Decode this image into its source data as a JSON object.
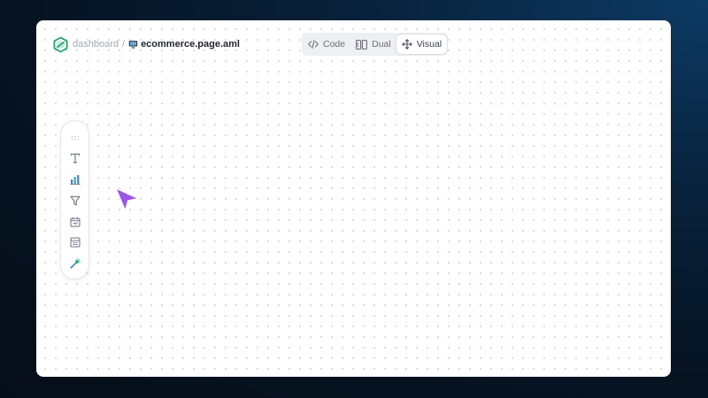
{
  "breadcrumb": {
    "root": "dashboard",
    "separator": "/",
    "file_icon": "monitor-icon",
    "file": "ecommerce.page.aml"
  },
  "mode_switch": {
    "options": [
      {
        "label": "Code",
        "icon": "code-icon",
        "active": false
      },
      {
        "label": "Dual",
        "icon": "split-view-icon",
        "active": false
      },
      {
        "label": "Visual",
        "icon": "move-arrows-icon",
        "active": true
      }
    ]
  },
  "toolbar": {
    "items": [
      {
        "name": "drag-handle-icon"
      },
      {
        "name": "text-icon"
      },
      {
        "name": "bar-chart-icon"
      },
      {
        "name": "filter-icon"
      },
      {
        "name": "date-filter-icon"
      },
      {
        "name": "table-icon"
      },
      {
        "name": "magic-wand-icon"
      }
    ]
  },
  "colors": {
    "accent_purple": "#9b55e8",
    "brand_green": "#1f9e6a",
    "canvas": "#ffffff"
  }
}
